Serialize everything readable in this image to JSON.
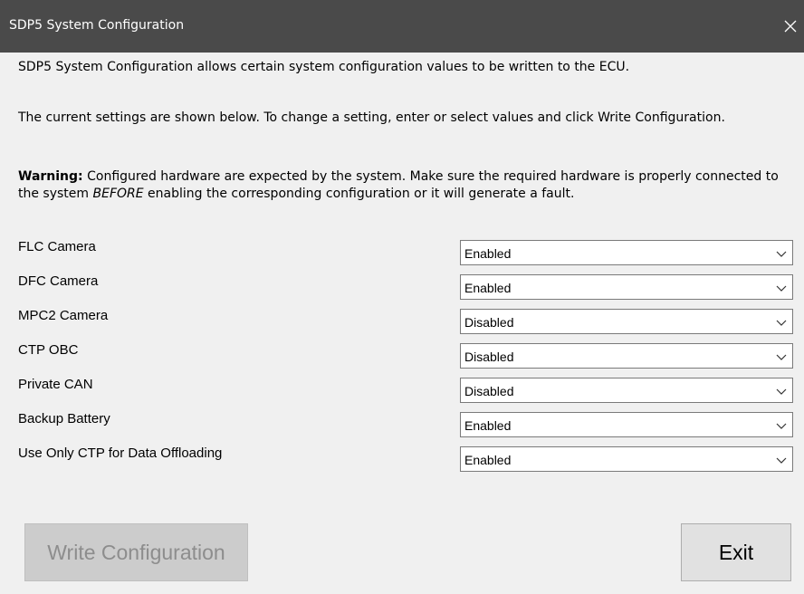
{
  "window": {
    "title": "SDP5 System Configuration",
    "close_glyph": "✕"
  },
  "intro": {
    "p1": "SDP5 System Configuration allows certain system configuration values to be written to the ECU.",
    "p2": "The current settings are shown below. To change a setting, enter or select values and click Write Configuration.",
    "warning_label": "Warning:",
    "warning_a": " Configured hardware are expected by the system. Make sure the required hardware is properly connected to the system ",
    "warning_em": "BEFORE",
    "warning_b": " enabling the corresponding configuration or it will generate a fault."
  },
  "settings": [
    {
      "label": "FLC Camera",
      "value": "Enabled"
    },
    {
      "label": "DFC Camera",
      "value": "Enabled"
    },
    {
      "label": "MPC2 Camera",
      "value": "Disabled"
    },
    {
      "label": "CTP OBC",
      "value": "Disabled"
    },
    {
      "label": "Private CAN",
      "value": "Disabled"
    },
    {
      "label": "Backup Battery",
      "value": "Enabled"
    },
    {
      "label": "Use Only CTP for Data Offloading",
      "value": "Enabled"
    }
  ],
  "buttons": {
    "write": "Write Configuration",
    "exit": "Exit"
  },
  "icons": {
    "close": "close-icon",
    "dropdown": "chevron-down-icon"
  },
  "colors": {
    "titlebar": "#4a4a4a",
    "disabled_button": "#cccccc",
    "disabled_text": "#8d8d8d"
  }
}
